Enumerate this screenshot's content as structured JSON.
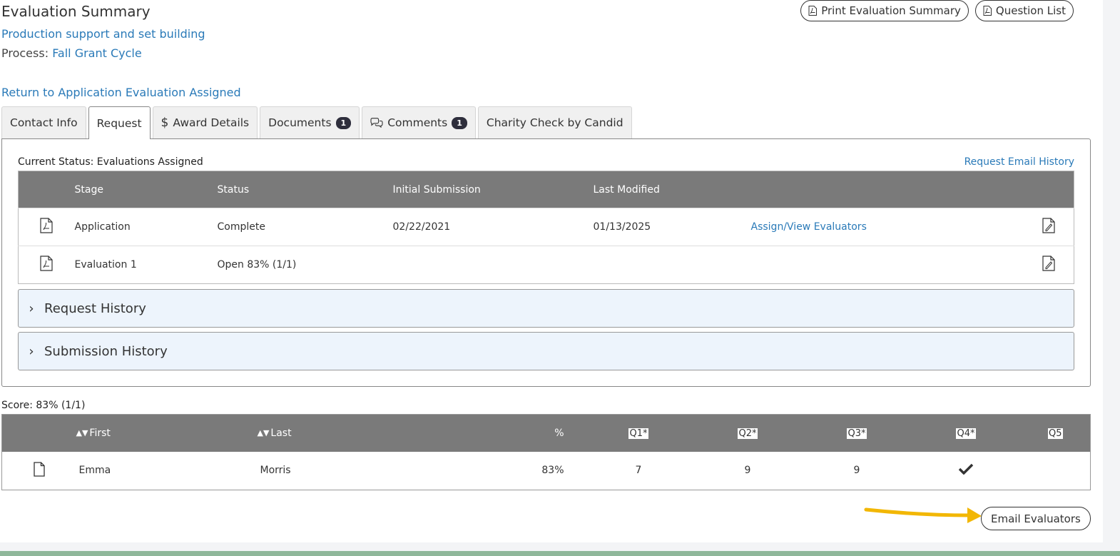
{
  "header": {
    "title": "Evaluation Summary",
    "subtitle": "Production support and set building",
    "process_label": "Process:",
    "process_value": "Fall Grant Cycle",
    "return_link": "Return to Application Evaluation Assigned",
    "print_button": "Print Evaluation Summary",
    "question_list_button": "Question List"
  },
  "tabs": [
    {
      "label": "Contact Info"
    },
    {
      "label": "Request",
      "active": true
    },
    {
      "label": "Award Details",
      "icon": "dollar-icon"
    },
    {
      "label": "Documents",
      "badge": "1"
    },
    {
      "label": "Comments",
      "badge": "1",
      "icon": "comments-icon"
    },
    {
      "label": "Charity Check by Candid"
    }
  ],
  "request_panel": {
    "current_status": "Current Status: Evaluations Assigned",
    "email_history_link": "Request Email History",
    "columns": [
      "Stage",
      "Status",
      "Initial Submission",
      "Last Modified"
    ],
    "rows": [
      {
        "stage": "Application",
        "status": "Complete",
        "initial": "02/22/2021",
        "modified": "01/13/2025",
        "action": "Assign/View Evaluators"
      },
      {
        "stage": "Evaluation 1",
        "status": "Open 83% (1/1)",
        "initial": "",
        "modified": "",
        "action": ""
      }
    ],
    "request_history": "Request History",
    "submission_history": "Submission History"
  },
  "evaluators": {
    "score": "Score: 83% (1/1)",
    "columns": {
      "first": "First",
      "last": "Last",
      "pct": "%",
      "q1": "Q1*",
      "q2": "Q2*",
      "q3": "Q3*",
      "q4": "Q4*",
      "q5": "Q5"
    },
    "rows": [
      {
        "first": "Emma",
        "last": "Morris",
        "pct": "83%",
        "q1": "7",
        "q2": "9",
        "q3": "9",
        "q4": "check",
        "q5": ""
      }
    ],
    "email_button": "Email Evaluators"
  },
  "colors": {
    "link": "#2a7ab8",
    "table_header": "#7a7a7a",
    "accordion_bg": "#edf4fc",
    "badge_bg": "#2e2e3c",
    "arrow": "#f2b705"
  }
}
